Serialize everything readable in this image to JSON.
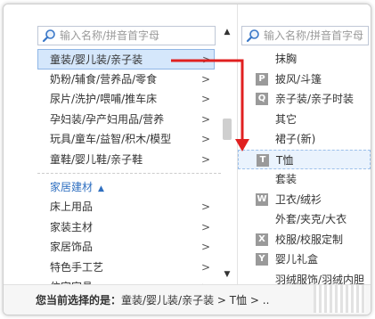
{
  "left": {
    "search_placeholder": "输入名称/拼音首字母",
    "items": [
      {
        "label": "童装/婴儿装/亲子装",
        "chev": ">"
      },
      {
        "label": "奶粉/辅食/营养品/零食",
        "chev": ">"
      },
      {
        "label": "尿片/洗护/喂哺/推车床",
        "chev": ">"
      },
      {
        "label": "孕妇装/孕产妇用品/营养",
        "chev": ">"
      },
      {
        "label": "玩具/童车/益智/积木/模型",
        "chev": ">"
      },
      {
        "label": "童鞋/婴儿鞋/亲子鞋",
        "chev": ">"
      }
    ],
    "group_header": "家居建材",
    "group_items": [
      {
        "label": "床上用品",
        "chev": ">"
      },
      {
        "label": "家装主材",
        "chev": ">"
      },
      {
        "label": "家居饰品",
        "chev": ">"
      },
      {
        "label": "特色手工艺",
        "chev": ">"
      },
      {
        "label": "住宅家具",
        "chev": ">"
      }
    ]
  },
  "right": {
    "search_placeholder": "输入名称/拼音首字母",
    "items": [
      {
        "letter": "",
        "label": "抹胸"
      },
      {
        "letter": "P",
        "label": "披风/斗篷"
      },
      {
        "letter": "Q",
        "label": "亲子装/亲子时装"
      },
      {
        "letter": "",
        "label": "其它"
      },
      {
        "letter": "",
        "label": "裙子(新)"
      },
      {
        "letter": "T",
        "label": "T恤"
      },
      {
        "letter": "",
        "label": "套装"
      },
      {
        "letter": "W",
        "label": "卫衣/绒衫"
      },
      {
        "letter": "",
        "label": "外套/夹克/大衣"
      },
      {
        "letter": "X",
        "label": "校服/校服定制"
      },
      {
        "letter": "Y",
        "label": "婴儿礼盒"
      },
      {
        "letter": "",
        "label": "羽绒服饰/羽绒内胆"
      }
    ]
  },
  "footer": {
    "prefix": "您当前选择的是：",
    "path": "童装/婴儿装/亲子装 > T恤 > .."
  },
  "colors": {
    "selected_bg": "#d5e7fb",
    "accent_blue": "#2f6fc0",
    "arrow_red": "#e02020"
  }
}
